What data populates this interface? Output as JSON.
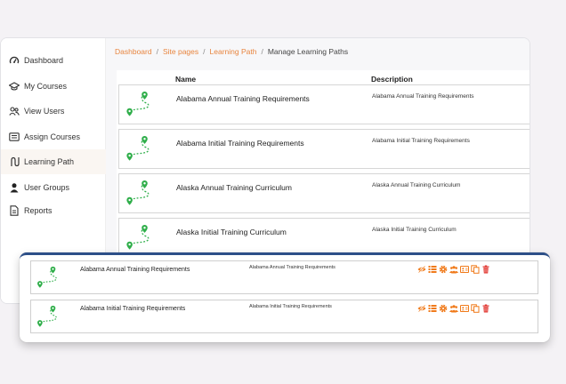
{
  "sidebar": {
    "items": [
      {
        "label": "Dashboard",
        "icon": "gauge-icon"
      },
      {
        "label": "My Courses",
        "icon": "graduation-cap-icon"
      },
      {
        "label": "View Users",
        "icon": "users-icon"
      },
      {
        "label": "Assign Courses",
        "icon": "list-card-icon"
      },
      {
        "label": "Learning Path",
        "icon": "route-icon"
      },
      {
        "label": "User Groups",
        "icon": "user-icon"
      },
      {
        "label": "Reports",
        "icon": "document-icon"
      }
    ],
    "active_index": 4
  },
  "breadcrumb": {
    "items": [
      "Dashboard",
      "Site pages",
      "Learning Path"
    ],
    "current": "Manage Learning Paths",
    "separator": "/"
  },
  "table": {
    "headers": {
      "name": "Name",
      "description": "Description"
    },
    "rows": [
      {
        "name": "Alabama Annual Training Requirements",
        "description": "Alabama Annual Training Requirements"
      },
      {
        "name": "Alabama Initial Training Requirements",
        "description": "Alabama Initial Training Requirements"
      },
      {
        "name": "Alaska Annual Training Curriculum",
        "description": "Alaska Annual Training Curriculum"
      },
      {
        "name": "Alaska Initial Training Curriculum",
        "description": "Alaska Initial Training Curriculum"
      }
    ]
  },
  "overlay": {
    "rows": [
      {
        "name": "Alabama Annual Training Requirements",
        "description": "Alabama Annual Training Requirements"
      },
      {
        "name": "Alabama Initial Training Requirements",
        "description": "Alabama Initial Training Requirements"
      }
    ],
    "action_icons": [
      "hide-eye-icon",
      "list-icon",
      "gear-icon",
      "user-group-icon",
      "id-card-icon",
      "copy-icon",
      "trash-icon"
    ]
  },
  "colors": {
    "accent": "#e8853f",
    "route_green": "#2fae4a",
    "overlay_border": "#2d4f88",
    "action_orange": "#f07a1a",
    "delete_red": "#e0302a"
  }
}
